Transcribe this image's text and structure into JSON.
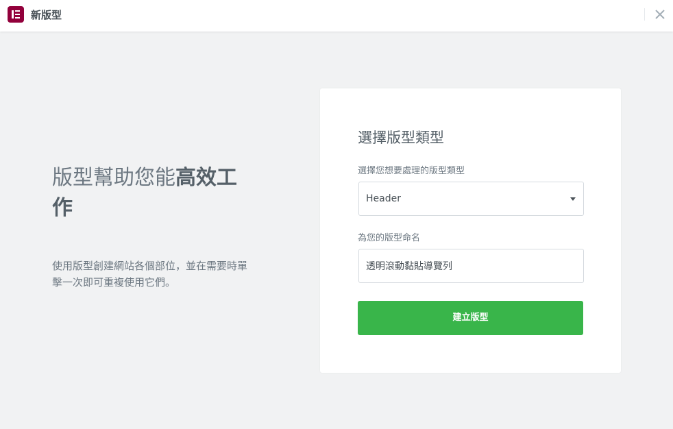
{
  "app": {
    "title": "新版型",
    "logo_icon": "elementor-logo-icon",
    "close_icon": "close-icon"
  },
  "intro": {
    "title_regular": "版型幫助您能",
    "title_bold": "高效工",
    "title_regular_end": "作",
    "description": "使用版型創建網站各個部位，並在需要時單擊一次即可重複使用它們。"
  },
  "form": {
    "title": "選擇版型類型",
    "type_label": "選擇您想要處理的版型類型",
    "type_value": "Header",
    "name_label": "為您的版型命名",
    "name_value": "透明滾動黏貼導覽列",
    "submit_label": "建立版型"
  },
  "colors": {
    "brand": "#92003b",
    "accent_green": "#39b54a",
    "background": "#f1f2f3"
  }
}
